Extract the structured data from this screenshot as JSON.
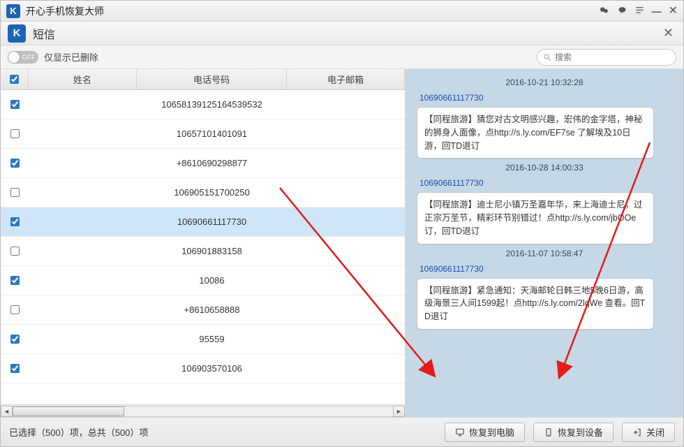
{
  "app": {
    "logo_letter": "K",
    "title": "开心手机恢复大师"
  },
  "subheader": {
    "title": "短信"
  },
  "toolbar": {
    "toggle_text": "OFF",
    "toggle_label": "仅显示已删除",
    "search_placeholder": "搜索"
  },
  "table": {
    "headers": {
      "name": "姓名",
      "phone": "电话号码",
      "email": "电子邮箱"
    },
    "rows": [
      {
        "checked": true,
        "name": "",
        "phone": "10658139125164539532",
        "selected": false
      },
      {
        "checked": false,
        "name": "",
        "phone": "10657101401091",
        "selected": false
      },
      {
        "checked": true,
        "name": "",
        "phone": "+8610690298877",
        "selected": false
      },
      {
        "checked": false,
        "name": "",
        "phone": "106905151700250",
        "selected": false
      },
      {
        "checked": true,
        "name": "",
        "phone": "10690661117730",
        "selected": true
      },
      {
        "checked": false,
        "name": "",
        "phone": "106901883158",
        "selected": false
      },
      {
        "checked": true,
        "name": "",
        "phone": "10086",
        "selected": false
      },
      {
        "checked": false,
        "name": "",
        "phone": "+8610658888",
        "selected": false
      },
      {
        "checked": true,
        "name": "",
        "phone": "95559",
        "selected": false
      },
      {
        "checked": true,
        "name": "",
        "phone": "106903570106",
        "selected": false
      }
    ]
  },
  "conversation": {
    "groups": [
      {
        "timestamp": "2016-10-21 10:32:28",
        "sender": "10690661117730",
        "body": "【同程旅游】猜您对古文明感兴趣，宏伟的金字塔，神秘的狮身人面像，点http://s.ly.com/EF7se 了解埃及10日游，回TD退订"
      },
      {
        "timestamp": "2016-10-28 14:00:33",
        "sender": "10690661117730",
        "body": "【同程旅游】迪士尼小镇万圣嘉年华，来上海迪士尼，过正宗万圣节，精彩环节别错过！点http://s.ly.com/jbOOe 订，回TD退订"
      },
      {
        "timestamp": "2016-11-07 10:58:47",
        "sender": "10690661117730",
        "body": "【同程旅游】紧急通知：天海邮轮日韩三地5晚6日游，高级海景三人间1599起！点http://s.ly.com/2lqWe 查看。回TD退订"
      }
    ]
  },
  "footer": {
    "status": "已选择（500）项，总共（500）项",
    "btn_to_pc": "恢复到电脑",
    "btn_to_device": "恢复到设备",
    "btn_close": "关闭"
  }
}
